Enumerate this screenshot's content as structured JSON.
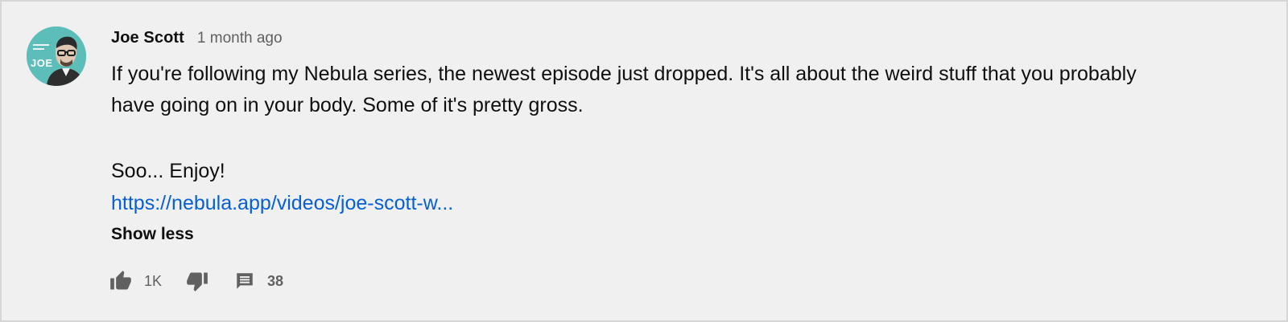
{
  "comment": {
    "author": "Joe Scott",
    "timestamp": "1 month ago",
    "avatar_text": "JOE",
    "lines": [
      "If you're following my Nebula series, the newest episode just dropped. It's all about the weird stuff that you probably have going on in your body. Some of it's pretty gross.",
      "Soo... Enjoy!"
    ],
    "link_text": "https://nebula.app/videos/joe-scott-w...",
    "show_less_label": "Show less"
  },
  "actions": {
    "like_count": "1K",
    "reply_count": "38",
    "like_icon": "thumbs-up-icon",
    "dislike_icon": "thumbs-down-icon",
    "reply_icon": "comment-icon"
  },
  "colors": {
    "background": "#f0f0f0",
    "link": "#065fd4",
    "text": "#0f0f0f",
    "muted": "#606060",
    "avatar": "#5dbdb9"
  }
}
